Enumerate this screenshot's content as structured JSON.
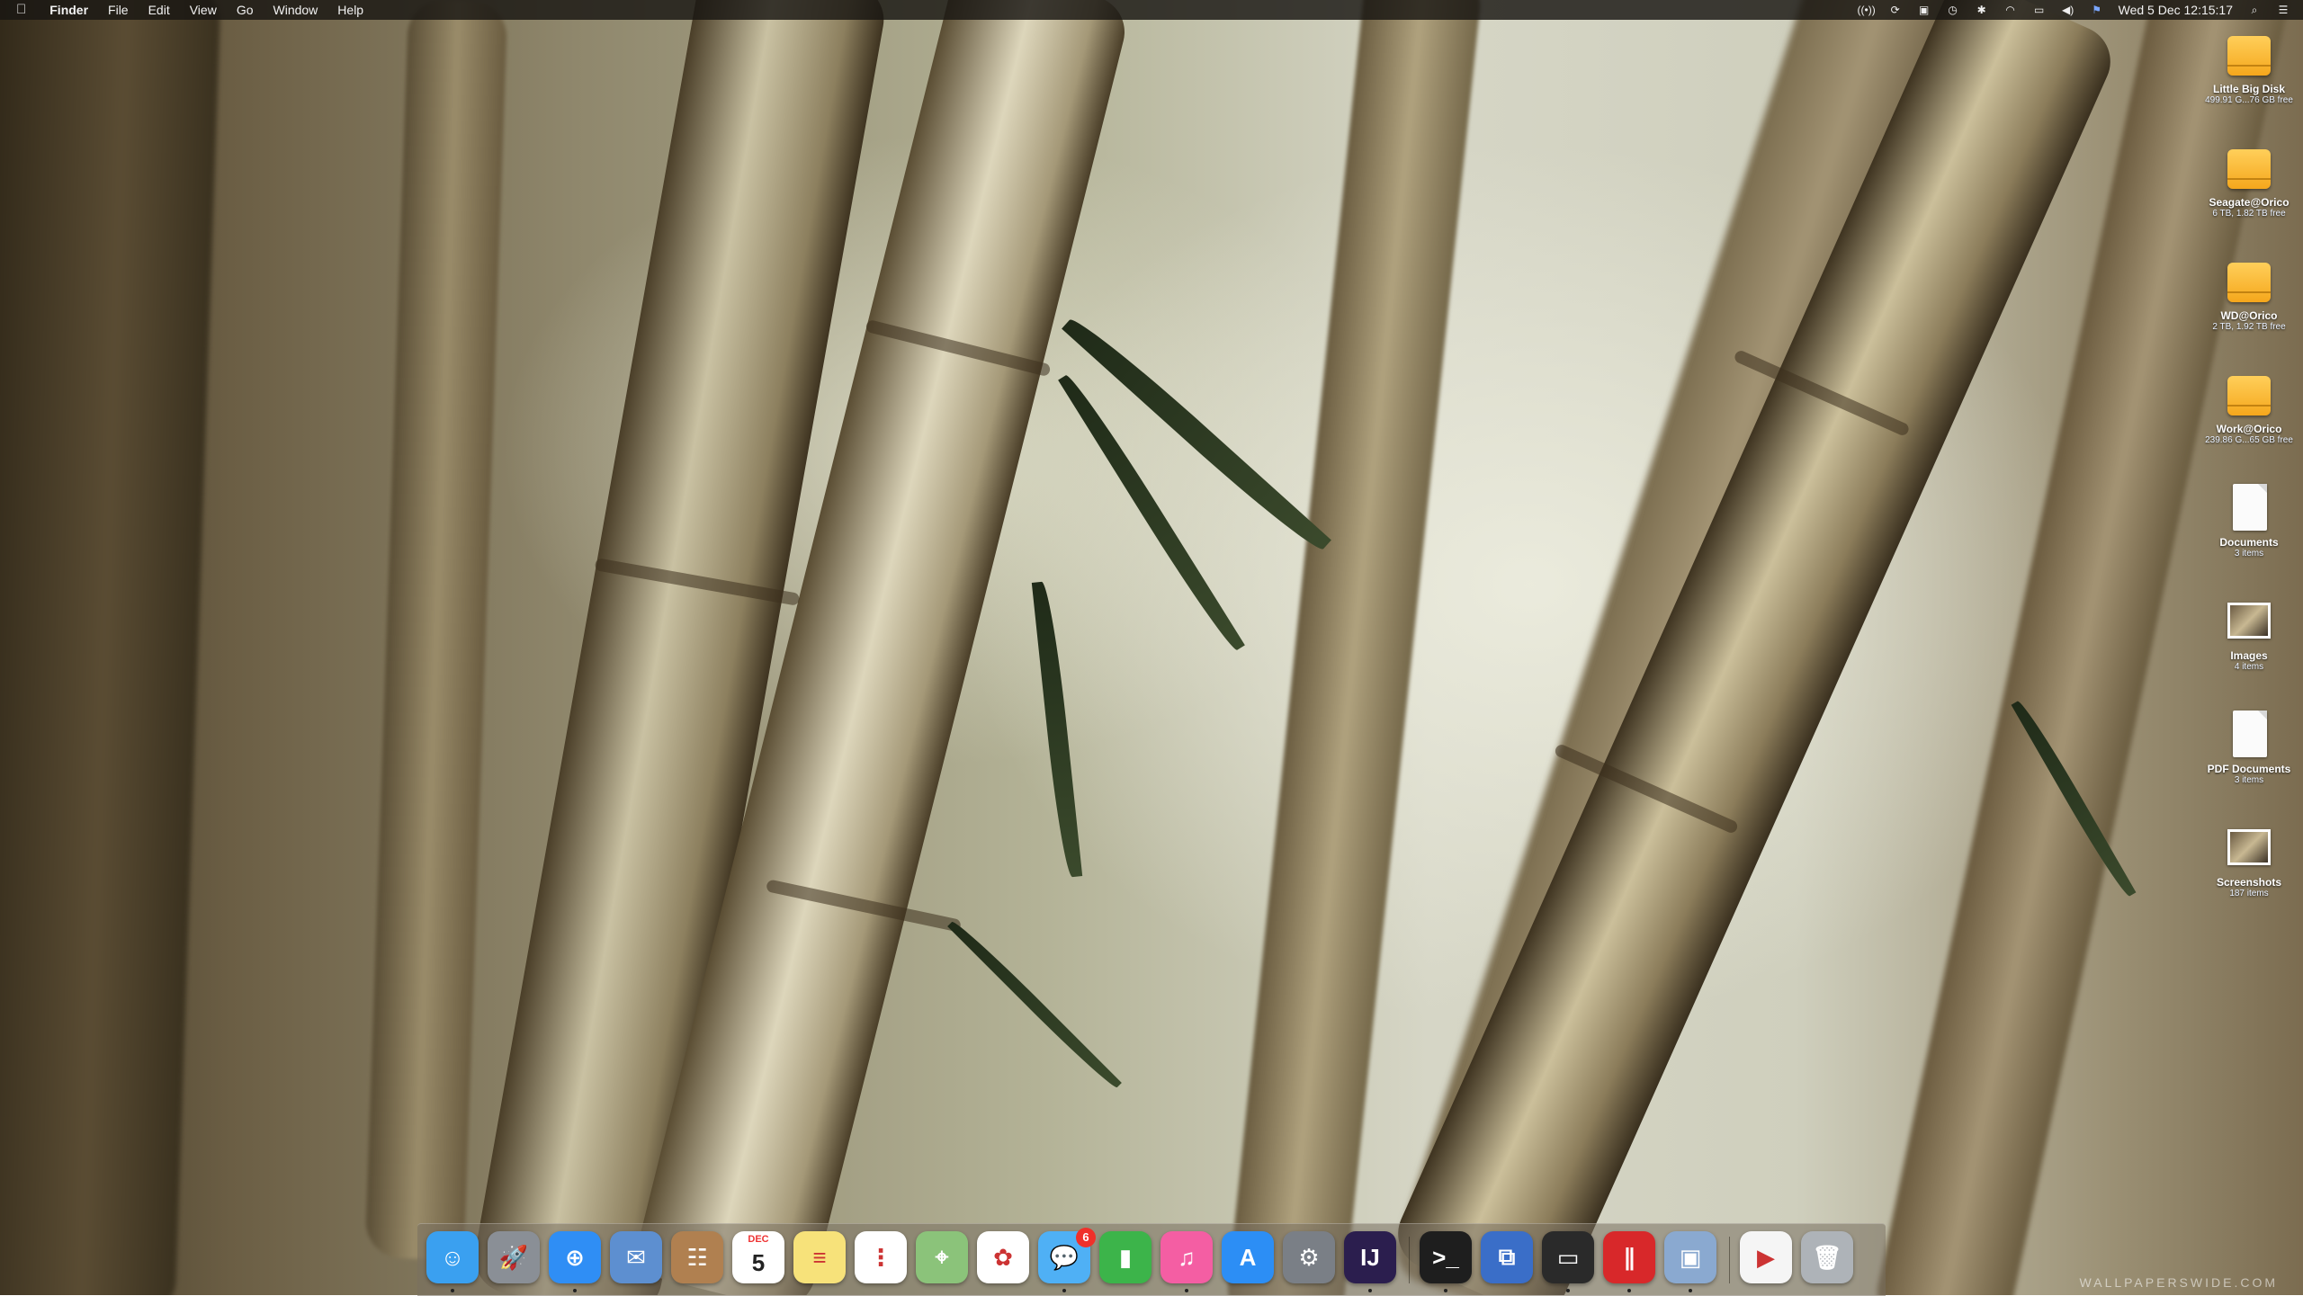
{
  "menubar": {
    "apple_icon": "apple-icon",
    "app_name": "Finder",
    "menus": [
      "File",
      "Edit",
      "View",
      "Go",
      "Window",
      "Help"
    ],
    "status_icons": [
      "broadcast-icon",
      "sync-icon",
      "screen-icon",
      "time-machine-icon",
      "bluetooth-icon",
      "wifi-icon",
      "airplay-icon",
      "volume-icon",
      "flag-icon"
    ],
    "clock": "Wed 5 Dec  12:15:17",
    "spotlight_icon": "search-icon",
    "notification_icon": "list-icon"
  },
  "desktop": {
    "items": [
      {
        "name": "Little Big Disk",
        "info": "499.91 G...76 GB free",
        "kind": "drive"
      },
      {
        "name": "Seagate@Orico",
        "info": "6 TB, 1.82 TB free",
        "kind": "drive"
      },
      {
        "name": "WD@Orico",
        "info": "2 TB, 1.92 TB free",
        "kind": "drive"
      },
      {
        "name": "Work@Orico",
        "info": "239.86 G...65 GB free",
        "kind": "drive"
      },
      {
        "name": "Documents",
        "info": "3 items",
        "kind": "document"
      },
      {
        "name": "Images",
        "info": "4 items",
        "kind": "photo"
      },
      {
        "name": "PDF Documents",
        "info": "3 items",
        "kind": "document"
      },
      {
        "name": "Screenshots",
        "info": "187 items",
        "kind": "photo"
      }
    ]
  },
  "dock": {
    "apps": [
      {
        "name": "Finder",
        "icon": "finder-icon",
        "color": "#3aa0f0",
        "glyph": "☺",
        "running": true
      },
      {
        "name": "Launchpad",
        "icon": "rocket-icon",
        "color": "#8a8f96",
        "glyph": "🚀",
        "running": false
      },
      {
        "name": "Safari",
        "icon": "compass-icon",
        "color": "#2f8ef5",
        "glyph": "⊕",
        "running": true
      },
      {
        "name": "Mail",
        "icon": "mail-icon",
        "color": "#5d8fd0",
        "glyph": "✉",
        "running": false
      },
      {
        "name": "Contacts",
        "icon": "contacts-icon",
        "color": "#b08050",
        "glyph": "☷",
        "running": false
      },
      {
        "name": "Calendar",
        "icon": "calendar-icon",
        "color": "#ffffff",
        "glyph": "5",
        "month": "DEC",
        "running": false
      },
      {
        "name": "Notes",
        "icon": "notes-icon",
        "color": "#f7e27a",
        "glyph": "≡",
        "running": false
      },
      {
        "name": "Reminders",
        "icon": "reminders-icon",
        "color": "#ffffff",
        "glyph": "⋮",
        "running": false
      },
      {
        "name": "Maps",
        "icon": "map-icon",
        "color": "#8bc37a",
        "glyph": "⌖",
        "running": false
      },
      {
        "name": "Photos",
        "icon": "photos-icon",
        "color": "#ffffff",
        "glyph": "✿",
        "running": false
      },
      {
        "name": "Messages",
        "icon": "messages-icon",
        "color": "#4fb0f5",
        "glyph": "💬",
        "badge": "6",
        "running": true
      },
      {
        "name": "Numbers",
        "icon": "chart-icon",
        "color": "#3cb44a",
        "glyph": "▮",
        "running": false
      },
      {
        "name": "iTunes",
        "icon": "music-icon",
        "color": "#f45ea3",
        "glyph": "♫",
        "running": true
      },
      {
        "name": "App Store",
        "icon": "app-store-icon",
        "color": "#2c8ef5",
        "glyph": "A",
        "running": false
      },
      {
        "name": "System Preferences",
        "icon": "gear-icon",
        "color": "#7a7f86",
        "glyph": "⚙",
        "running": false
      },
      {
        "name": "IntelliJ IDEA",
        "icon": "intellij-icon",
        "color": "#2b1e4e",
        "glyph": "IJ",
        "running": true
      },
      {
        "name": "Terminal",
        "icon": "terminal-icon",
        "color": "#1e1e1e",
        "glyph": ">_",
        "running": true
      },
      {
        "name": "Parallels",
        "icon": "windows-icon",
        "color": "#3a6ec8",
        "glyph": "⧉",
        "running": false
      },
      {
        "name": "Screen Sharing",
        "icon": "monitor-icon",
        "color": "#2a2a2a",
        "glyph": "▭",
        "running": true
      },
      {
        "name": "Parallels Desktop",
        "icon": "parallels-icon",
        "color": "#d8282a",
        "glyph": "∥",
        "running": true
      },
      {
        "name": "VirtualBox",
        "icon": "virtualbox-icon",
        "color": "#8aa9d0",
        "glyph": "▣",
        "running": true
      },
      {
        "name": "Downloads",
        "icon": "document-icon",
        "color": "#f5f5f5",
        "glyph": "▶",
        "running": false
      },
      {
        "name": "Trash",
        "icon": "trash-icon",
        "color": "#aeb3b8",
        "glyph": "🗑",
        "running": false
      }
    ]
  },
  "watermark": "WALLPAPERSWIDE.COM"
}
